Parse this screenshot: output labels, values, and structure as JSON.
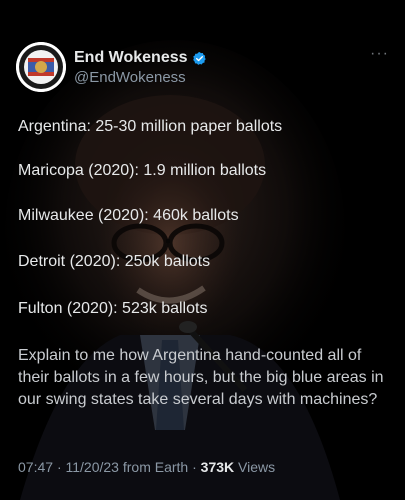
{
  "account": {
    "display_name": "End Wokeness",
    "handle": "@EndWokeness",
    "verified": true,
    "avatar_badge_text": "SUPPORT LAW ENFORCEMENT"
  },
  "tweet": {
    "lines": [
      "Argentina: 25-30 million paper ballots",
      "Maricopa (2020): 1.9 million ballots",
      "Milwaukee (2020): 460k ballots",
      "Detroit (2020): 250k ballots",
      "Fulton (2020): 523k ballots"
    ],
    "question": "Explain to me how Argentina hand-counted all of their ballots in a few hours, but the big blue areas in our swing states take several days with machines?"
  },
  "meta": {
    "time": "07:47",
    "date": "11/20/23",
    "source": "from Earth",
    "separator": "·",
    "views_count": "373K",
    "views_label": "Views"
  },
  "colors": {
    "background": "#000000",
    "text": "#e7e9ea",
    "secondary": "#8b98a5",
    "verified": "#1d9bf0"
  }
}
